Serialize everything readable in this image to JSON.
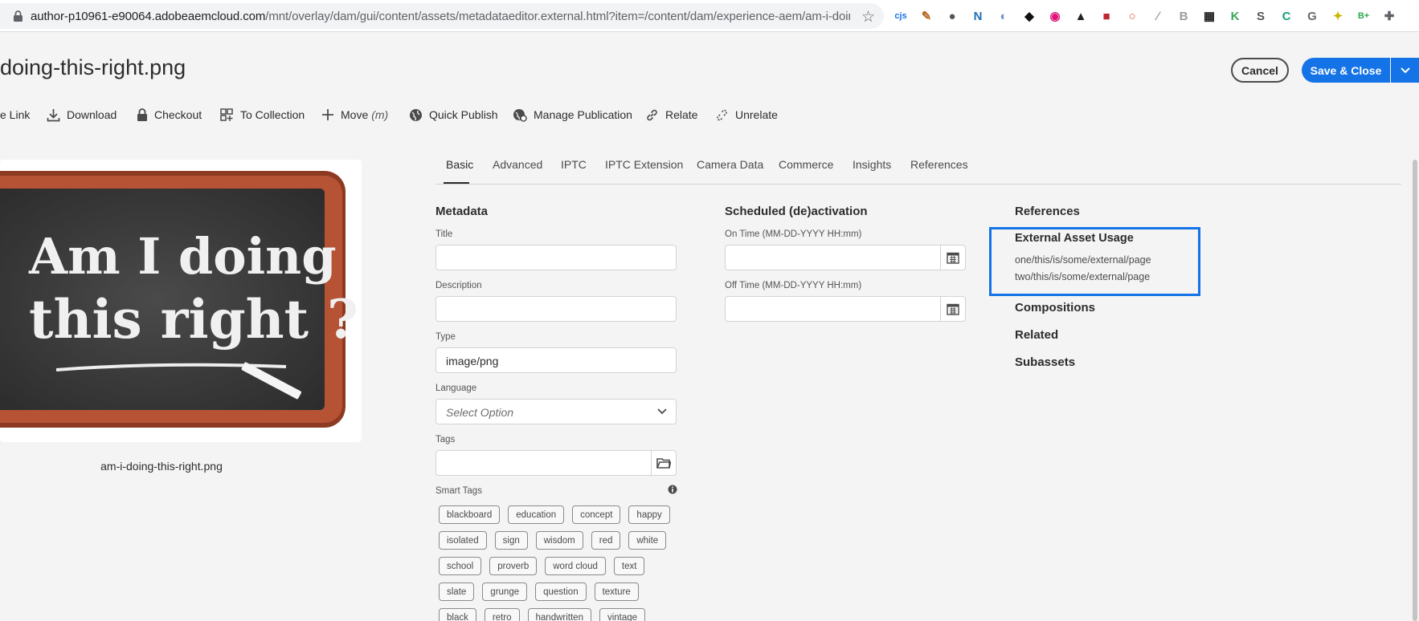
{
  "browser": {
    "url_host": "author-p10961-e90064.adobeaemcloud.com",
    "url_path": "/mnt/overlay/dam/gui/content/assets/metadataeditor.external.html?item=/content/dam/experience-aem/am-i-doing-t...",
    "extensions": [
      {
        "icon": "cjs-extension-icon",
        "text": "cjs",
        "color": "#1a73e8"
      },
      {
        "icon": "pen-extension-icon",
        "text": "✎",
        "color": "#b5651d"
      },
      {
        "icon": "circle-extension-icon",
        "text": "●",
        "color": "#555555"
      },
      {
        "icon": "n-extension-icon",
        "text": "N",
        "color": "#1f6fb2"
      },
      {
        "icon": "compass-extension-icon",
        "text": "◐",
        "color": "#6a8fc7"
      },
      {
        "icon": "spy-extension-icon",
        "text": "◆",
        "color": "#111111"
      },
      {
        "icon": "eye-extension-icon",
        "text": "◉",
        "color": "#e0137a"
      },
      {
        "icon": "drive-extension-icon",
        "text": "▲",
        "color": "#222222"
      },
      {
        "icon": "red-square-extension-icon",
        "text": "■",
        "color": "#c0262d"
      },
      {
        "icon": "ring-extension-icon",
        "text": "○",
        "color": "#d4582a"
      },
      {
        "icon": "feather-extension-icon",
        "text": "∕",
        "color": "#9a9a9a"
      },
      {
        "icon": "b-extension-icon",
        "text": "B",
        "color": "#9a9a9a"
      },
      {
        "icon": "table-extension-icon",
        "text": "▦",
        "color": "#222222"
      },
      {
        "icon": "arrow-extension-icon",
        "text": "K",
        "color": "#3aa655"
      },
      {
        "icon": "s-extension-icon",
        "text": "S",
        "color": "#555555"
      },
      {
        "icon": "c-extension-icon",
        "text": "C",
        "color": "#15a37f"
      },
      {
        "icon": "g-extension-icon",
        "text": "G",
        "color": "#6b6b6b"
      },
      {
        "icon": "pin-extension-icon",
        "text": "✦",
        "color": "#c9b800"
      },
      {
        "icon": "bplus-extension-icon",
        "text": "B+",
        "color": "#2fa84f"
      },
      {
        "icon": "puzzle-extension-icon",
        "text": "✚",
        "color": "#5f6368"
      }
    ]
  },
  "header": {
    "title": "doing-this-right.png",
    "cancel_label": "Cancel",
    "save_label": "Save & Close"
  },
  "toolbar": {
    "copy_link": "e Link",
    "download": "Download",
    "checkout": "Checkout",
    "to_collection": "To Collection",
    "move": "Move",
    "move_shortcut": "(m)",
    "quick_publish": "Quick Publish",
    "manage_publication": "Manage Publication",
    "relate": "Relate",
    "unrelate": "Unrelate"
  },
  "preview": {
    "line1": "Am I doing",
    "line2": "this right ?",
    "caption": "am-i-doing-this-right.png"
  },
  "tabs": [
    "Basic",
    "Advanced",
    "IPTC",
    "IPTC Extension",
    "Camera Data",
    "Commerce",
    "Insights",
    "References"
  ],
  "metadata": {
    "heading": "Metadata",
    "title_label": "Title",
    "title_value": "",
    "description_label": "Description",
    "description_value": "",
    "type_label": "Type",
    "type_value": "image/png",
    "language_label": "Language",
    "language_placeholder": "Select Option",
    "tags_label": "Tags",
    "tags_value": "",
    "smart_tags_label": "Smart Tags",
    "smart_tags": [
      [
        "blackboard",
        "education",
        "concept",
        "happy"
      ],
      [
        "isolated",
        "sign",
        "wisdom",
        "red",
        "white"
      ],
      [
        "school",
        "proverb",
        "word cloud",
        "text"
      ],
      [
        "slate",
        "grunge",
        "question",
        "texture"
      ],
      [
        "black",
        "retro",
        "handwritten",
        "vintage"
      ]
    ]
  },
  "scheduled": {
    "heading": "Scheduled (de)activation",
    "on_label": "On Time (MM-DD-YYYY HH:mm)",
    "on_value": "",
    "off_label": "Off Time (MM-DD-YYYY HH:mm)",
    "off_value": ""
  },
  "references": {
    "heading": "References",
    "external_heading": "External Asset Usage",
    "external_items": [
      "one/this/is/some/external/page",
      "two/this/is/some/external/page"
    ],
    "compositions": "Compositions",
    "related": "Related",
    "subassets": "Subassets"
  },
  "colors": {
    "accent": "#1473e6",
    "board_frame": "#a0432a",
    "board_slate": "#3f3f3f"
  }
}
